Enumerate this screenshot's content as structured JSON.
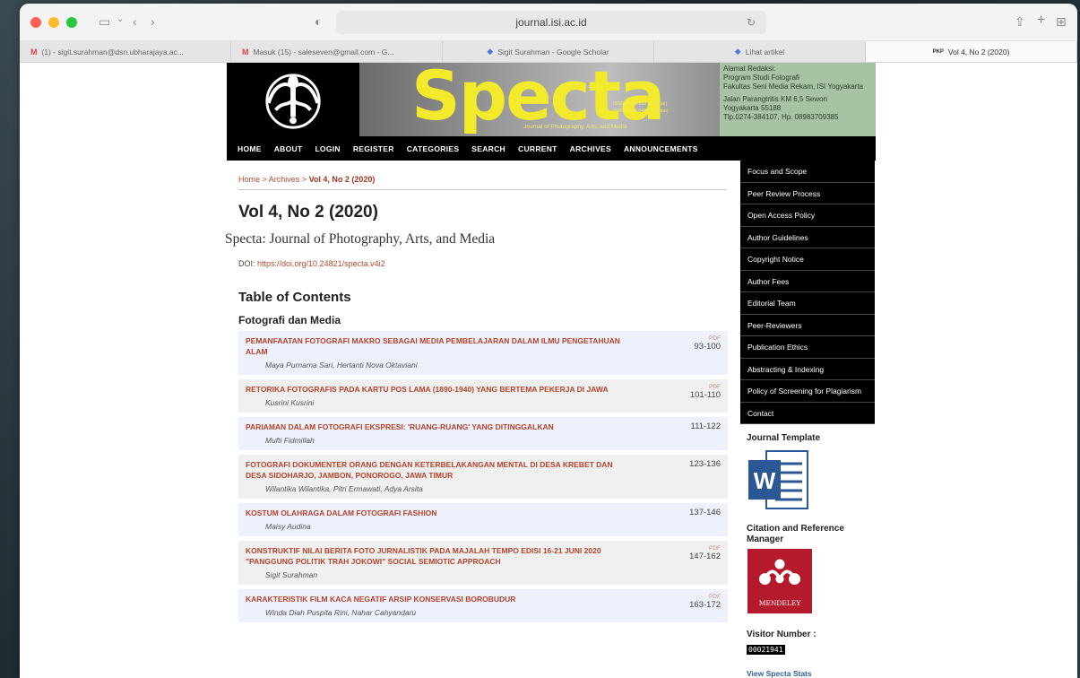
{
  "browser": {
    "url": "journal.isi.ac.id",
    "tabs": [
      {
        "icon": "M",
        "label": "(1) - sigit.surahman@dsn.ubharajaya.ac..."
      },
      {
        "icon": "M",
        "label": "Masuk (15) - saleseven@gmail.com - G..."
      },
      {
        "icon": "◆",
        "label": "Sigit Surahman - Google Scholar"
      },
      {
        "icon": "◆",
        "label": "Lihat artikel"
      },
      {
        "icon": "PKP",
        "label": "Vol 4, No 2 (2020)"
      }
    ]
  },
  "banner": {
    "title": "Specta",
    "subtitle": "Journal of Photography, Arts, and Media",
    "issn_print": "ISSN 2614-3577 (Cetak)",
    "issn_online": "ISSN 2614-0453 (Online)",
    "address": [
      "Alamat Redaksi:",
      "Program Studi Fotografi",
      "Fakultas Seni Media Rekam, ISI Yogyakarta",
      "Jalan Parangtritis KM 6,5 Sewon",
      "Yogyakarta 55188",
      "Tlp.0274-384107, Hp. 08983709385"
    ]
  },
  "nav": [
    "HOME",
    "ABOUT",
    "LOGIN",
    "REGISTER",
    "CATEGORIES",
    "SEARCH",
    "CURRENT",
    "ARCHIVES",
    "ANNOUNCEMENTS"
  ],
  "breadcrumb": {
    "home": "Home",
    "sep": " > ",
    "archives": "Archives",
    "current": "Vol 4, No 2 (2020)"
  },
  "issue_title": "Vol 4, No 2 (2020)",
  "journal_title": "Specta: Journal of Photography, Arts, and Media",
  "doi": {
    "label": "DOI: ",
    "link": "https://doi.org/10.24821/specta.v4i2"
  },
  "toc_title": "Table of Contents",
  "section_title": "Fotografi dan Media",
  "articles": [
    {
      "title": "PEMANFAATAN FOTOGRAFI MAKRO SEBAGAI MEDIA PEMBELAJARAN DALAM ILMU PENGETAHUAN ALAM",
      "authors": "Maya Purnama Sari, Hertanti Nova Oktaviani",
      "pdf": "PDF",
      "pages": "93-100"
    },
    {
      "title": "RETORIKA FOTOGRAFIS PADA KARTU POS LAMA (1890-1940) YANG BERTEMA PEKERJA DI JAWA",
      "authors": "Kusrini Kusrini",
      "pdf": "PDF",
      "pages": "101-110"
    },
    {
      "title": "PARIAMAN DALAM FOTOGRAFI EKSPRESI: 'RUANG-RUANG' YANG DITINGGALKAN",
      "authors": "Mufti Fidmillah",
      "pdf": "",
      "pages": "111-122"
    },
    {
      "title": "FOTOGRAFI DOKUMENTER ORANG DENGAN KETERBELAKANGAN MENTAL DI DESA KREBET DAN DESA SIDOHARJO, JAMBON, PONOROGO, JAWA TIMUR",
      "authors": "Wilantika Wilantika, Pitri Ermawati, Adya Arsita",
      "pdf": "",
      "pages": "123-136"
    },
    {
      "title": "KOSTUM OLAHRAGA DALAM FOTOGRAFI FASHION",
      "authors": "Maisy Audina",
      "pdf": "",
      "pages": "137-146"
    },
    {
      "title": "KONSTRUKTIF NILAI BERITA FOTO JURNALISTIK PADA MAJALAH TEMPO EDISI 16-21 JUNI 2020 \"PANGGUNG POLITIK TRAH JOKOWI\" SOCIAL SEMIOTIC APPROACH",
      "authors": "Sigit Surahman",
      "pdf": "PDF",
      "pages": "147-162"
    },
    {
      "title": "KARAKTERISTIK FILM KACA NEGATIF ARSIP KONSERVASI BOROBUDUR",
      "authors": "Winda Diah Puspita Rini, Nahar Cahyandaru",
      "pdf": "PDF",
      "pages": "163-172"
    }
  ],
  "sidebar": {
    "items": [
      "Focus and Scope",
      "Peer Review Process",
      "Open Access Policy",
      "Author Guidelines",
      "Copyright Notice",
      "Author Fees",
      "Editorial Team",
      "Peer-Reviewers",
      "Publication Ethics",
      "Abstracting & Indexing",
      "Policy of Screening for Plagiarism",
      "Contact"
    ],
    "journal_template": "Journal Template",
    "citation_manager": "Citation and Reference Manager",
    "mendeley_label": "MENDELEY",
    "word_letter": "W",
    "visitor_label": "Visitor Number :",
    "visitor_count": "00021941",
    "stats_link": "View Specta Stats"
  },
  "colors": {
    "accent": "#b3432c",
    "banner_yellow": "#f2ea2a",
    "address_green": "#a8c3a3"
  }
}
